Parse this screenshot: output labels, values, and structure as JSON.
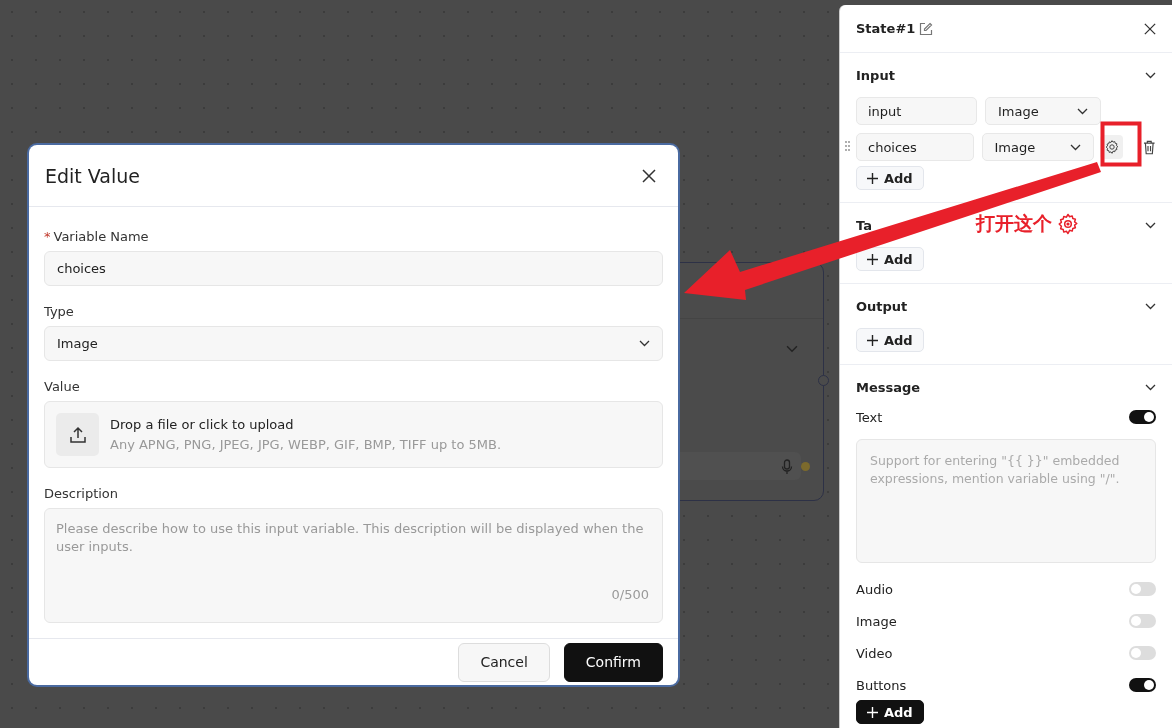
{
  "modal": {
    "title": "Edit Value",
    "fields": [
      {
        "kind": "text",
        "marker": "*",
        "label": "Variable Name",
        "value": "choices"
      },
      {
        "kind": "select",
        "label": "Type",
        "value": "Image"
      },
      {
        "kind": "upload",
        "label": "Value",
        "title": "Drop a file or click to upload",
        "hint": "Any APNG, PNG, JPEG, JPG, WEBP, GIF, BMP, TIFF up to 5MB."
      },
      {
        "kind": "textarea",
        "label": "Description",
        "placeholder": "Please describe how to use this input variable. This description will be displayed when the user inputs.",
        "count": "0/500"
      }
    ],
    "buttons": [
      {
        "label": "Cancel",
        "kind": "secondary"
      },
      {
        "label": "Confirm",
        "kind": "primary"
      }
    ]
  },
  "panel": {
    "title": "State#1",
    "sections": [
      {
        "title": "Input",
        "variables": [
          {
            "name": "input",
            "type": "Image",
            "hovered": false
          },
          {
            "name": "choices",
            "type": "Image",
            "hovered": true
          }
        ],
        "add_label": "Add"
      },
      {
        "title": "Ta",
        "add_label": "Add"
      },
      {
        "title": "Output",
        "add_label": "Add"
      },
      {
        "title": "Message",
        "items": [
          {
            "kind": "toggle",
            "label": "Text",
            "on": true
          },
          {
            "kind": "textarea",
            "placeholder": "Support for entering \"{{ }}\" embedded expressions, mention variable using \"/\"."
          },
          {
            "kind": "toggle",
            "label": "Audio",
            "on": false
          },
          {
            "kind": "toggle",
            "label": "Image",
            "on": false
          },
          {
            "kind": "toggle",
            "label": "Video",
            "on": false
          },
          {
            "kind": "toggle",
            "label": "Buttons",
            "on": true
          },
          {
            "kind": "button",
            "label": "Add"
          }
        ]
      }
    ]
  },
  "annotation": {
    "text": "打开这个"
  }
}
